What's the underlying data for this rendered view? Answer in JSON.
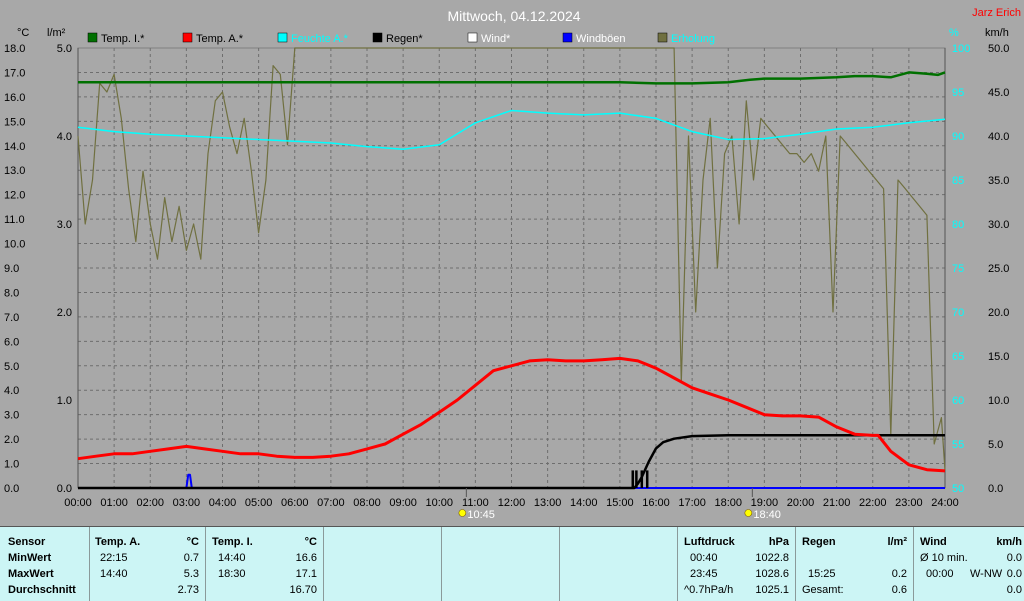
{
  "title": "Mittwoch, 04.12.2024",
  "author": "Jarz Erich",
  "axis_units": {
    "temp": "°C",
    "rain": "l/m²",
    "hum": "%",
    "wind": "km/h"
  },
  "legend": [
    {
      "label": "Temp. I.*",
      "color": "#007000",
      "text_color": "#000000"
    },
    {
      "label": "Temp. A.*",
      "color": "#ff0000",
      "text_color": "#000000"
    },
    {
      "label": "Feuchte A.*",
      "color": "#00ffff",
      "text_color": "#00ffff"
    },
    {
      "label": "Regen*",
      "color": "#000000",
      "text_color": "#000000"
    },
    {
      "label": "Wind*",
      "color": "#ffffff",
      "text_color": "#ffffff"
    },
    {
      "label": "Windböen",
      "color": "#0000ff",
      "text_color": "#ffffff"
    },
    {
      "label": "Erholung",
      "color": "#707040",
      "text_color": "#00ffff"
    }
  ],
  "sun_markers": [
    {
      "time": "10:45"
    },
    {
      "time": "18:40"
    }
  ],
  "chart_data": {
    "type": "line",
    "x_ticks": [
      "00:00",
      "01:00",
      "02:00",
      "03:00",
      "04:00",
      "05:00",
      "06:00",
      "07:00",
      "08:00",
      "09:00",
      "10:00",
      "11:00",
      "12:00",
      "13:00",
      "14:00",
      "15:00",
      "16:00",
      "17:00",
      "18:00",
      "19:00",
      "20:00",
      "21:00",
      "22:00",
      "23:00",
      "24:00"
    ],
    "xlim": [
      0,
      24
    ],
    "axes": {
      "temp": {
        "label": "°C",
        "range": [
          0,
          18
        ],
        "ticks": [
          "0.0",
          "1.0",
          "2.0",
          "3.0",
          "4.0",
          "5.0",
          "6.0",
          "7.0",
          "8.0",
          "9.0",
          "10.0",
          "11.0",
          "12.0",
          "13.0",
          "14.0",
          "15.0",
          "16.0",
          "17.0",
          "18.0"
        ]
      },
      "rain": {
        "label": "l/m²",
        "range": [
          0,
          5
        ],
        "ticks": [
          "0.0",
          "1.0",
          "2.0",
          "3.0",
          "4.0",
          "5.0"
        ]
      },
      "hum": {
        "label": "%",
        "range": [
          50,
          100
        ],
        "ticks": [
          "50",
          "55",
          "60",
          "65",
          "70",
          "75",
          "80",
          "85",
          "90",
          "95",
          "100"
        ]
      },
      "wind": {
        "label": "km/h",
        "range": [
          0,
          50
        ],
        "ticks": [
          "0.0",
          "5.0",
          "10.0",
          "15.0",
          "20.0",
          "25.0",
          "30.0",
          "35.0",
          "40.0",
          "45.0",
          "50.0"
        ]
      }
    },
    "grid": true,
    "series": [
      {
        "name": "Temp. I.*",
        "axis": "temp",
        "color": "#007000",
        "x": [
          0,
          5,
          10,
          15,
          16,
          17,
          18,
          18.6,
          19,
          20,
          21,
          21.5,
          22,
          22.5,
          23,
          23.5,
          23.8,
          24
        ],
        "y": [
          16.6,
          16.6,
          16.6,
          16.6,
          16.55,
          16.55,
          16.6,
          16.7,
          16.75,
          16.75,
          16.8,
          16.85,
          16.85,
          16.8,
          17.0,
          16.95,
          16.9,
          17.0
        ]
      },
      {
        "name": "Temp. A.*",
        "axis": "temp",
        "color": "#ff0000",
        "x": [
          0,
          0.5,
          1,
          1.5,
          2,
          2.5,
          3,
          3.5,
          4,
          4.5,
          5,
          5.5,
          6,
          6.5,
          7,
          7.5,
          8,
          8.5,
          9,
          9.5,
          10,
          10.5,
          11,
          11.5,
          12,
          12.5,
          13,
          13.5,
          14,
          14.5,
          15,
          15.5,
          16,
          16.5,
          17,
          17.5,
          18,
          18.5,
          19,
          19.5,
          20,
          20.5,
          21,
          21.5,
          22,
          22.15,
          22.5,
          23,
          23.5,
          24
        ],
        "y": [
          1.2,
          1.3,
          1.4,
          1.4,
          1.5,
          1.6,
          1.7,
          1.6,
          1.5,
          1.4,
          1.4,
          1.3,
          1.25,
          1.25,
          1.3,
          1.4,
          1.6,
          1.8,
          2.2,
          2.6,
          3.1,
          3.6,
          4.2,
          4.8,
          5.0,
          5.2,
          5.25,
          5.2,
          5.2,
          5.25,
          5.3,
          5.2,
          4.9,
          4.5,
          4.1,
          3.85,
          3.6,
          3.3,
          3.0,
          2.95,
          2.95,
          2.9,
          2.5,
          2.2,
          2.15,
          2.15,
          1.5,
          0.95,
          0.75,
          0.7
        ]
      },
      {
        "name": "Feuchte A.*",
        "axis": "hum",
        "color": "#00ffff",
        "x": [
          0,
          1,
          2,
          3,
          4,
          5,
          6,
          7,
          8,
          9,
          10,
          11,
          12,
          13,
          14,
          15,
          16,
          17,
          18,
          19,
          20,
          21,
          22,
          23,
          24
        ],
        "y": [
          91,
          90.5,
          90.2,
          90,
          89.8,
          89.6,
          89.4,
          89.2,
          88.8,
          88.5,
          89.0,
          91.5,
          92.9,
          92.6,
          92.4,
          92.6,
          92.0,
          90.5,
          89.6,
          89.7,
          90.2,
          90.8,
          91.0,
          91.5,
          91.9
        ]
      },
      {
        "name": "Regen*",
        "axis": "rain",
        "color": "#000000",
        "x": [
          0,
          15.4,
          15.5,
          15.6,
          15.8,
          16.0,
          16.2,
          16.5,
          17,
          18,
          19,
          20,
          21,
          22,
          23,
          24
        ],
        "y": [
          0,
          0,
          0.05,
          0.12,
          0.3,
          0.45,
          0.52,
          0.56,
          0.59,
          0.6,
          0.6,
          0.6,
          0.6,
          0.6,
          0.6,
          0.6
        ]
      },
      {
        "name": "Windböen",
        "axis": "wind",
        "color": "#0000ff",
        "x": [
          0,
          3.0,
          3.05,
          3.1,
          3.15,
          24
        ],
        "y": [
          0,
          0,
          1.5,
          1.5,
          0,
          0
        ]
      },
      {
        "name": "Erholung",
        "axis": "wind",
        "color": "#707040",
        "x": [
          0,
          0.2,
          0.4,
          0.6,
          0.8,
          1.0,
          1.2,
          1.4,
          1.6,
          1.8,
          2.0,
          2.2,
          2.4,
          2.6,
          2.8,
          3.0,
          3.2,
          3.4,
          3.6,
          3.8,
          4.0,
          4.2,
          4.4,
          4.6,
          4.8,
          5.0,
          5.2,
          5.4,
          5.6,
          5.8,
          6.0,
          6.5,
          7,
          8,
          9,
          10,
          11,
          12,
          13,
          14,
          15,
          15.5,
          16,
          16.5,
          16.7,
          16.9,
          17.1,
          17.3,
          17.5,
          17.7,
          17.9,
          18.1,
          18.3,
          18.5,
          18.7,
          18.9,
          19.1,
          19.3,
          19.5,
          19.7,
          19.9,
          20.1,
          20.3,
          20.5,
          20.7,
          20.9,
          21.1,
          21.3,
          21.5,
          21.7,
          21.9,
          22.1,
          22.3,
          22.5,
          22.7,
          22.9,
          23.1,
          23.3,
          23.5,
          23.7,
          23.9,
          24
        ],
        "y": [
          40,
          30,
          35,
          46,
          45,
          47,
          42,
          34,
          28,
          36,
          30,
          26,
          33,
          28,
          32,
          27,
          30,
          26,
          38,
          44,
          45,
          41,
          38,
          42,
          36,
          29,
          35,
          48,
          47,
          39,
          50,
          50,
          50,
          50,
          50,
          50,
          50,
          50,
          50,
          50,
          50,
          50,
          50,
          50,
          12,
          40,
          20,
          35,
          42,
          25,
          38,
          40,
          30,
          44,
          35,
          42,
          41,
          40,
          39,
          38,
          38,
          37,
          38,
          36,
          40,
          20,
          40,
          39,
          38,
          37,
          36,
          35,
          34,
          6,
          35,
          34,
          33,
          32,
          31,
          5,
          8,
          2
        ]
      }
    ]
  },
  "stats": {
    "row_labels": {
      "sensor": "Sensor",
      "min": "MinWert",
      "max": "MaxWert",
      "avg": "Durchschnitt"
    },
    "temp_a": {
      "header": "Temp. A.",
      "unit": "°C",
      "min_time": "22:15",
      "min_val": "0.7",
      "max_time": "14:40",
      "max_val": "5.3",
      "avg": "2.73"
    },
    "temp_i": {
      "header": "Temp. I.",
      "unit": "°C",
      "min_time": "14:40",
      "min_val": "16.6",
      "max_time": "18:30",
      "max_val": "17.1",
      "avg": "16.70"
    },
    "pressure": {
      "header": "Luftdruck",
      "unit": "hPa",
      "min_time": "00:40",
      "min_val": "1022.8",
      "max_time": "23:45",
      "max_val": "1028.6",
      "trend": "^0.7hPa/h",
      "avg": "1025.1"
    },
    "rain": {
      "header": "Regen",
      "unit": "l/m²",
      "max_time": "15:25",
      "max_val": "0.2",
      "total_label": "Gesamt:",
      "total": "0.6"
    },
    "wind": {
      "header": "Wind",
      "unit": "km/h",
      "avg10_label": "Ø 10 min.",
      "avg10": "0.0",
      "max_time": "00:00",
      "max_dir": "W-NW",
      "max_val": "0.0",
      "avg": "0.0"
    }
  }
}
